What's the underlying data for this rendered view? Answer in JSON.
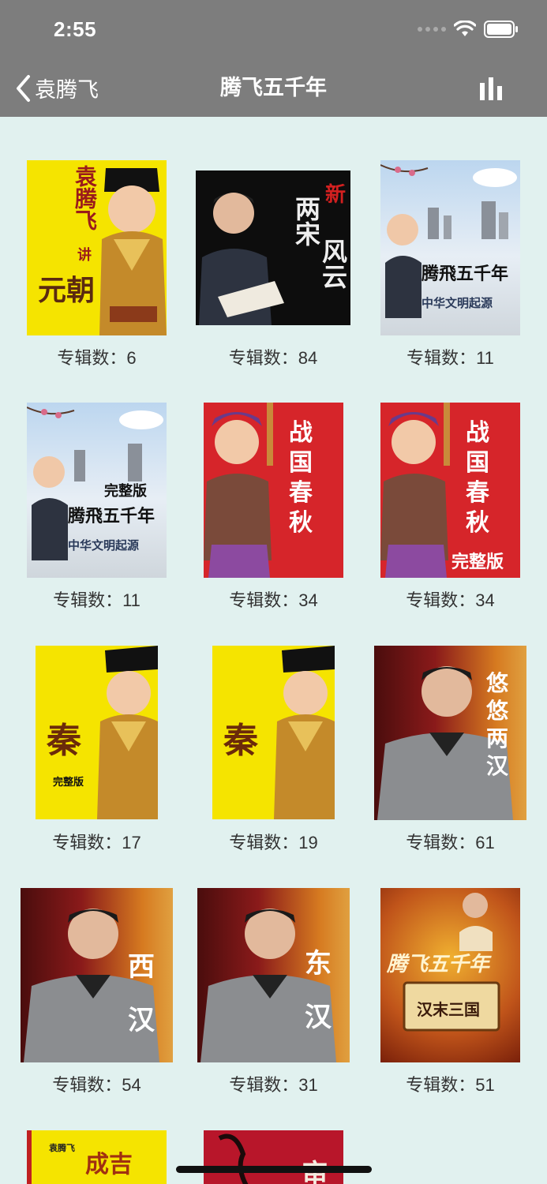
{
  "status": {
    "time": "2:55"
  },
  "nav": {
    "back_label": "袁腾飞",
    "title": "腾飞五千年"
  },
  "albums": [
    {
      "count_label": "专辑数：6",
      "cover_text": [
        "袁腾飞",
        "讲",
        "元朝"
      ]
    },
    {
      "count_label": "专辑数：84",
      "cover_text": [
        "新",
        "两宋",
        "风云"
      ]
    },
    {
      "count_label": "专辑数：11",
      "cover_text": [
        "腾飛五千年",
        "中华文明起源"
      ]
    },
    {
      "count_label": "专辑数：11",
      "cover_text": [
        "完整版",
        "腾飛五千年",
        "中华文明起源"
      ]
    },
    {
      "count_label": "专辑数：34",
      "cover_text": [
        "战国春秋"
      ]
    },
    {
      "count_label": "专辑数：34",
      "cover_text": [
        "战国春秋",
        "完整版"
      ]
    },
    {
      "count_label": "专辑数：17",
      "cover_text": [
        "秦",
        "完整版"
      ]
    },
    {
      "count_label": "专辑数：19",
      "cover_text": [
        "秦"
      ]
    },
    {
      "count_label": "专辑数：61",
      "cover_text": [
        "悠悠两汉"
      ]
    },
    {
      "count_label": "专辑数：54",
      "cover_text": [
        "西汉"
      ]
    },
    {
      "count_label": "专辑数：31",
      "cover_text": [
        "东汉"
      ]
    },
    {
      "count_label": "专辑数：51",
      "cover_text": [
        "腾飞五千年",
        "汉末三国"
      ]
    },
    {
      "count_label": "",
      "cover_text": [
        "袁腾飞",
        "成吉"
      ]
    },
    {
      "count_label": "",
      "cover_text": [
        "审"
      ]
    }
  ],
  "colors": {
    "bar": "#7d7d7d",
    "background": "#e1f1ef",
    "yellow": "#f5e400",
    "red": "#d6252a"
  }
}
